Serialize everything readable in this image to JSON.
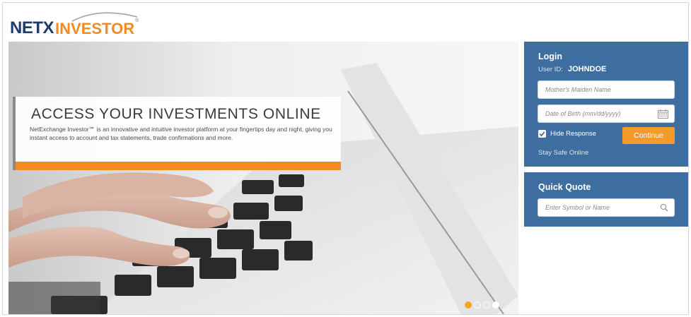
{
  "header": {
    "logo_primary": "NETX",
    "logo_secondary": "INVESTOR",
    "logo_tm": "®"
  },
  "hero": {
    "title": "ACCESS YOUR INVESTMENTS ONLINE",
    "description": "NetExchange Investor℠ is an innovative and intuitive investor platform at your fingertips day and night, giving you instant access to account and tax statements, trade confirmations and more.",
    "carousel": {
      "count": 4,
      "active_index": 0
    }
  },
  "login": {
    "title": "Login",
    "user_id_label": "User ID:",
    "user_id_value": "JOHNDOE",
    "maiden_name_placeholder": "Mother's Maiden Name",
    "dob_placeholder": "Date of Birth (mm/dd/yyyy)",
    "hide_response_label": "Hide Response",
    "hide_response_checked": true,
    "continue_label": "Continue",
    "stay_safe_link": "Stay Safe Online"
  },
  "quick_quote": {
    "title": "Quick Quote",
    "symbol_placeholder": "Enter Symbol or Name"
  },
  "colors": {
    "brand_navy": "#1e3c6e",
    "brand_orange": "#f38b21",
    "panel_blue": "#3e6e9f"
  },
  "icons": [
    "calendar-icon",
    "search-icon",
    "checkbox-check-icon"
  ]
}
